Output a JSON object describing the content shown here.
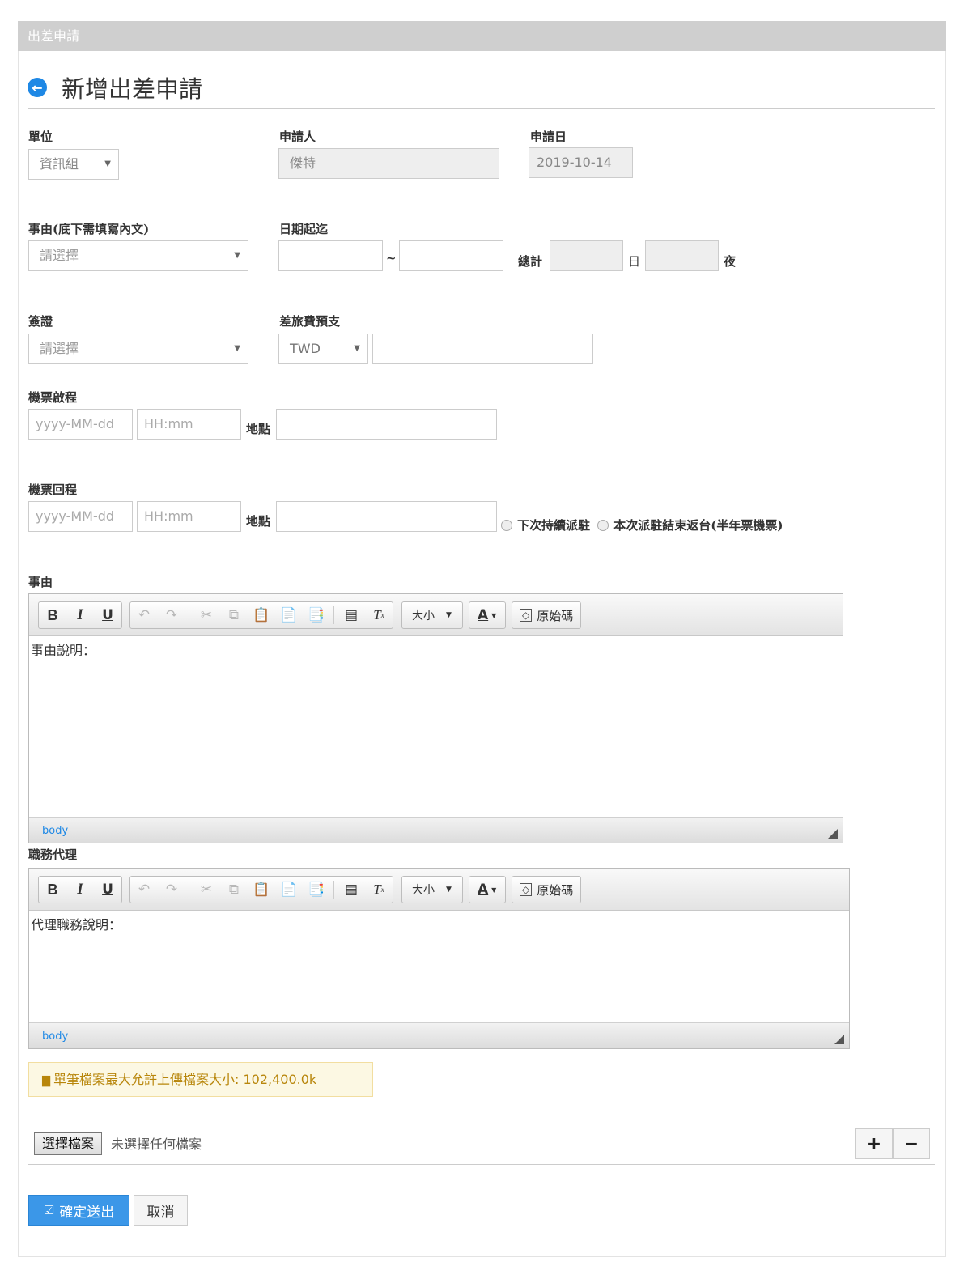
{
  "panel": {
    "header": "出差申請"
  },
  "page": {
    "title": "新增出差申請",
    "back_icon": "arrow-left-circle-icon"
  },
  "form": {
    "unit": {
      "label": "單位",
      "value": "資訊組"
    },
    "applicant": {
      "label": "申請人",
      "value": "傑特"
    },
    "apply_date": {
      "label": "申請日",
      "value": "2019-10-14"
    },
    "reason_type": {
      "label": "事由(底下需填寫內文)",
      "value": "請選擇"
    },
    "date_range": {
      "label": "日期起迄",
      "separator": "~",
      "start": "",
      "end": "",
      "total_label": "總計",
      "days_label": "日",
      "days": "",
      "nights_label": "夜",
      "nights": ""
    },
    "visa": {
      "label": "簽證",
      "value": "請選擇"
    },
    "advance": {
      "label": "差旅費預支",
      "currency": "TWD",
      "amount": ""
    },
    "depart": {
      "label": "機票啟程",
      "date_placeholder": "yyyy-MM-dd",
      "time_placeholder": "HH:mm",
      "place_label": "地點",
      "place": ""
    },
    "return": {
      "label": "機票回程",
      "date_placeholder": "yyyy-MM-dd",
      "time_placeholder": "HH:mm",
      "place_label": "地點",
      "place": "",
      "radio1": "下次持續派駐",
      "radio2": "本次派駐結束返台(半年票機票)"
    }
  },
  "editors": {
    "reason": {
      "label": "事由",
      "content": "事由說明：",
      "path": "body"
    },
    "agent": {
      "label": "職務代理",
      "content": "代理職務說明：",
      "path": "body"
    },
    "toolbar": {
      "bold": "B",
      "italic": "I",
      "underline": "U",
      "size": "大小",
      "color": "A",
      "source": "原始碼"
    }
  },
  "upload": {
    "notice": "單筆檔案最大允許上傳檔案大小: 102,400.0k",
    "choose_button": "選擇檔案",
    "no_file": "未選擇任何檔案",
    "add": "+",
    "remove": "−"
  },
  "actions": {
    "submit": "確定送出",
    "cancel": "取消"
  },
  "colors": {
    "primary": "#3b97e8",
    "header_bg": "#cfcfcf",
    "alert_bg": "#fcf8e3",
    "alert_text": "#b8860b",
    "link": "#1e88e5"
  }
}
